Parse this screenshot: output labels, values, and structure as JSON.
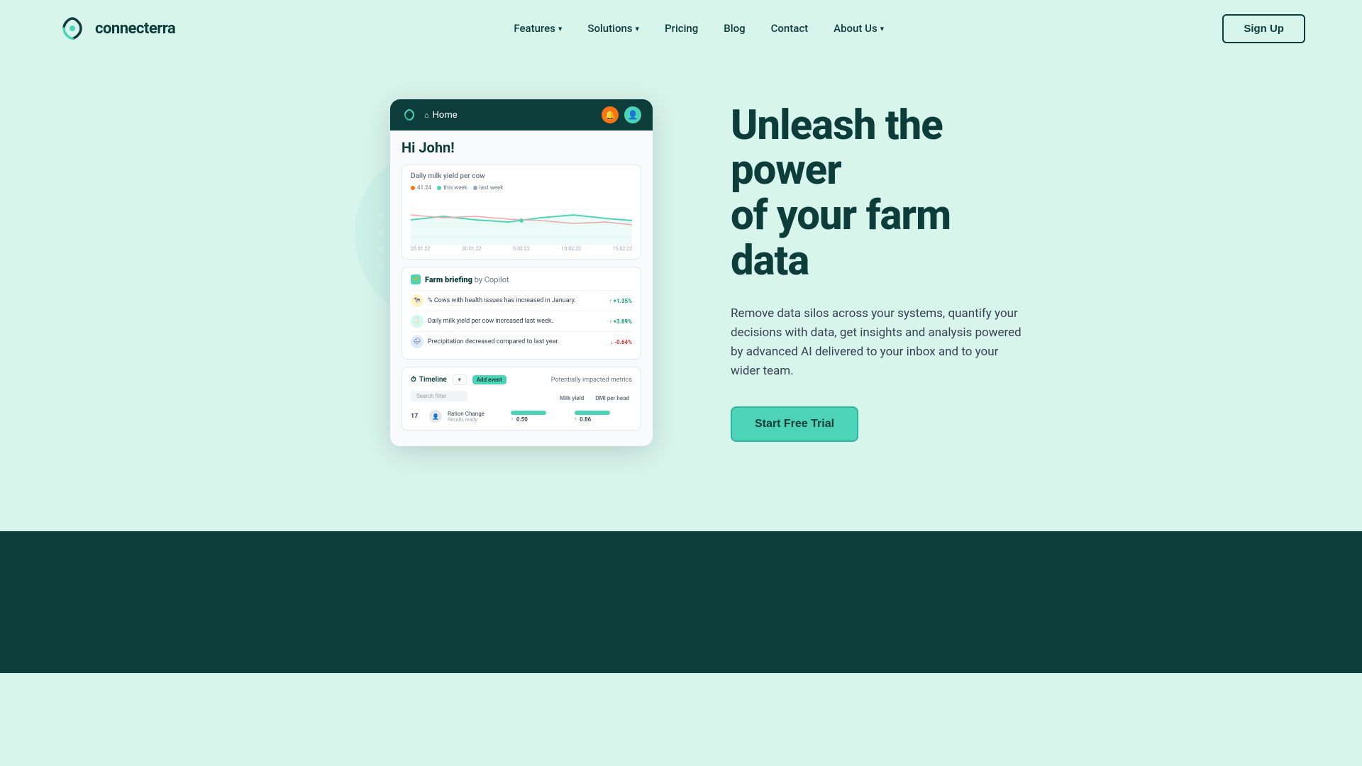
{
  "brand": {
    "name": "connecterra",
    "logo_alt": "Connecterra logo"
  },
  "navbar": {
    "signup_label": "Sign Up",
    "links": [
      {
        "label": "Features",
        "has_dropdown": true
      },
      {
        "label": "Solutions",
        "has_dropdown": true
      },
      {
        "label": "Pricing",
        "has_dropdown": false
      },
      {
        "label": "Blog",
        "has_dropdown": false
      },
      {
        "label": "Contact",
        "has_dropdown": false
      },
      {
        "label": "About Us",
        "has_dropdown": true
      }
    ]
  },
  "dashboard": {
    "header": {
      "home_label": "Home"
    },
    "greeting": "Hi John!",
    "chart_widget": {
      "title": "Daily milk yield per cow",
      "legend": [
        {
          "label": "41.24",
          "color": "#f97316"
        },
        {
          "label": "this week",
          "color": "#4dd4b8"
        },
        {
          "label": "last week",
          "color": "#94a3b8"
        }
      ],
      "x_labels": [
        "25.01.22",
        "30.01.22",
        "5.02.22",
        "10.02.22",
        "15.02.22"
      ]
    },
    "briefing": {
      "title": "Farm briefing",
      "by_label": "by Copilot",
      "items": [
        {
          "text": "% Cows with health issues has increased in January.",
          "badge": "+1.35%",
          "positive": true,
          "icon": "🐄"
        },
        {
          "text": "Daily milk yield per cow increased last week.",
          "badge": "+3.89%",
          "positive": true,
          "icon": "🥛"
        },
        {
          "text": "Precipitation decreased compared to last year.",
          "badge": "-0.64%",
          "positive": false,
          "icon": "🌧"
        }
      ]
    },
    "timeline": {
      "label": "Timeline",
      "add_event": "Add event",
      "search_placeholder": "Search filter",
      "potentially_label": "Potentially impacted metrics",
      "cols": [
        "Milk yield",
        "DMI per head"
      ],
      "row": {
        "date": "17",
        "event": "Ration Change",
        "sub": "Results ready",
        "milk_yield": "0.50",
        "dmi_per_head": "0.86"
      }
    }
  },
  "hero": {
    "headline_line1": "Unleash the power",
    "headline_line2": "of your farm data",
    "subtext": "Remove data silos across your systems, quantify your decisions with data, get insights and analysis powered by advanced AI delivered to your inbox and to your wider team.",
    "cta_label": "Start Free Trial"
  }
}
